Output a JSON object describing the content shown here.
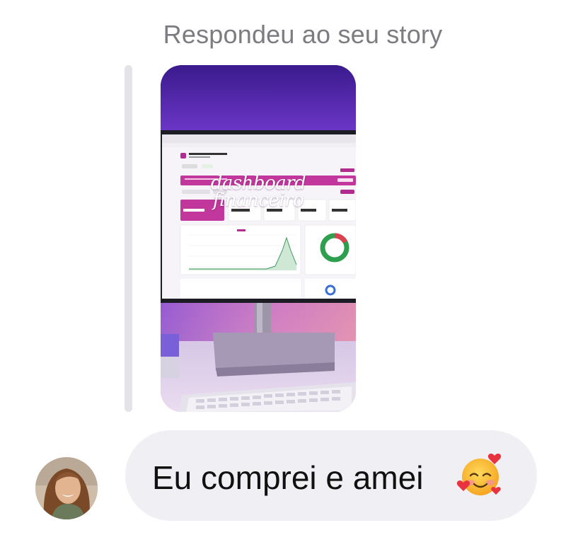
{
  "context": {
    "label": "Respondeu ao seu story"
  },
  "story": {
    "title_line1": "dashboard",
    "title_line2": "financeiro"
  },
  "message": {
    "text": "Eu comprei e amei",
    "emoji": "smiling-face-with-hearts-icon"
  },
  "sender": {
    "avatar": "avatar"
  },
  "colors": {
    "bubble": "#efeff4",
    "reply_bar": "#e3e3e8",
    "label_text": "#7c7c82",
    "story_accent": "#b02c8e"
  }
}
